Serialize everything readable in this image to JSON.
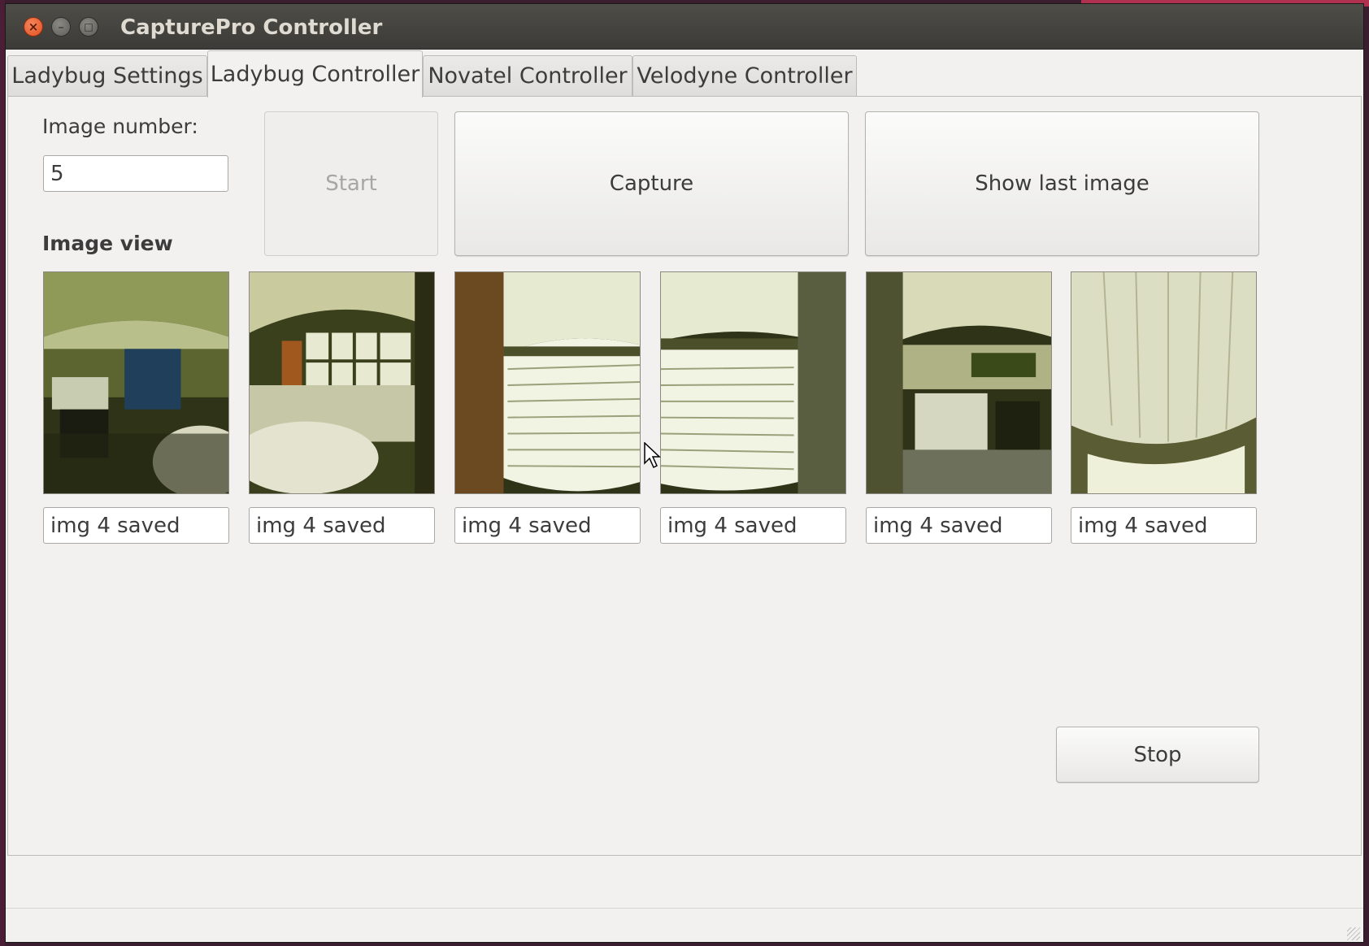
{
  "window": {
    "title": "CapturePro Controller"
  },
  "tabs": [
    {
      "label": "Ladybug Settings",
      "active": false
    },
    {
      "label": "Ladybug Controller",
      "active": true
    },
    {
      "label": "Novatel Controller",
      "active": false
    },
    {
      "label": "Velodyne Controller",
      "active": false
    }
  ],
  "controller": {
    "image_number_label": "Image number:",
    "image_number_value": "5",
    "image_view_label": "Image view",
    "start_label": "Start",
    "capture_label": "Capture",
    "show_last_label": "Show last image",
    "stop_label": "Stop"
  },
  "images": [
    {
      "status": "img 4 saved",
      "icon": "office-camera-0-icon"
    },
    {
      "status": "img 4 saved",
      "icon": "office-camera-1-icon"
    },
    {
      "status": "img 4 saved",
      "icon": "window-camera-2-icon"
    },
    {
      "status": "img 4 saved",
      "icon": "window-camera-3-icon"
    },
    {
      "status": "img 4 saved",
      "icon": "office-camera-4-icon"
    },
    {
      "status": "img 4 saved",
      "icon": "ceiling-camera-5-icon"
    }
  ],
  "colors": {
    "window_bg": "#f2f1f0",
    "titlebar": "#3c3b37",
    "close_button": "#e2501f",
    "image_tint": "#4a4f1e"
  }
}
